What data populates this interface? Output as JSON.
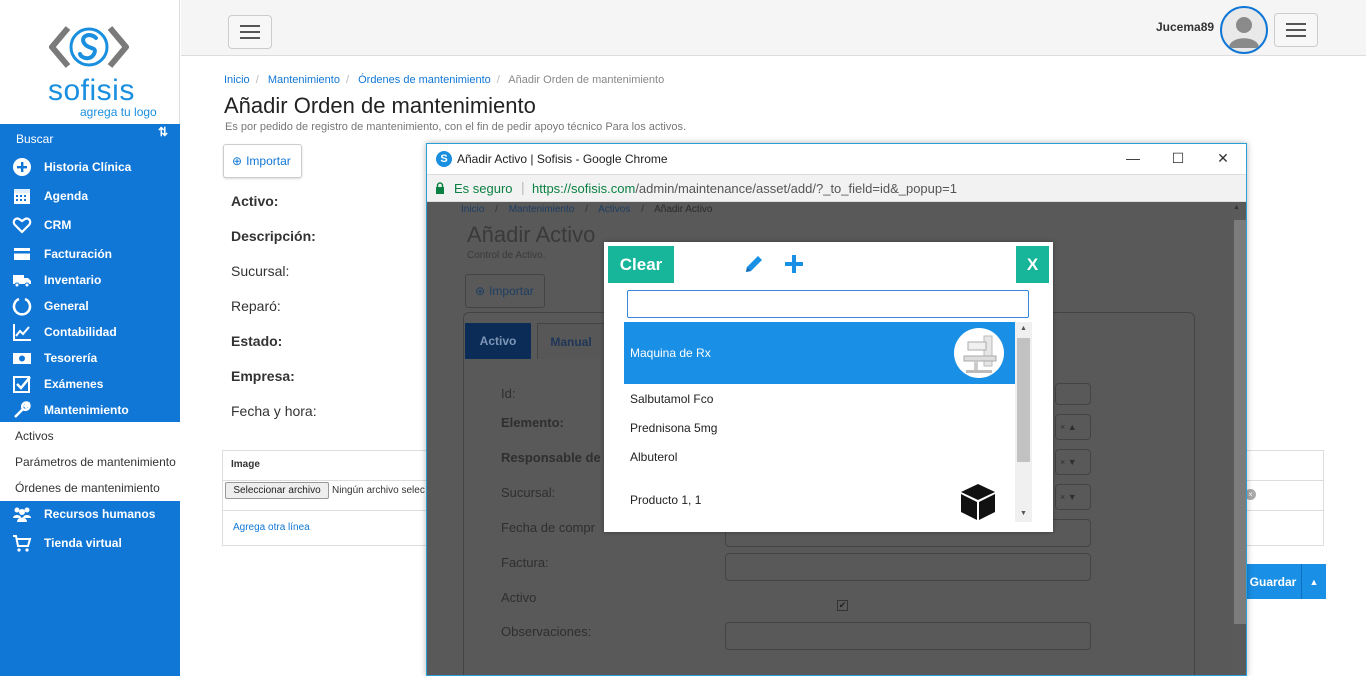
{
  "sidebar": {
    "logo_text": "sofisis",
    "logo_tagline": "agrega tu logo",
    "search_label": "Buscar",
    "items": [
      {
        "label": "Historia Clínica",
        "icon": "plus-square-icon"
      },
      {
        "label": "Agenda",
        "icon": "calendar-icon"
      },
      {
        "label": "CRM",
        "icon": "heart-icon"
      },
      {
        "label": "Facturación",
        "icon": "credit-card-icon"
      },
      {
        "label": "Inventario",
        "icon": "truck-icon"
      },
      {
        "label": "General",
        "icon": "circle-notch-icon"
      },
      {
        "label": "Contabilidad",
        "icon": "line-chart-icon"
      },
      {
        "label": "Tesorería",
        "icon": "money-icon"
      },
      {
        "label": "Exámenes",
        "icon": "check-square-icon"
      },
      {
        "label": "Mantenimiento",
        "icon": "wrench-icon"
      }
    ],
    "subitems": [
      {
        "label": "Activos"
      },
      {
        "label": "Parámetros de mantenimiento"
      },
      {
        "label": "Órdenes de mantenimiento"
      }
    ],
    "bottom_items": [
      {
        "label": "Recursos humanos",
        "icon": "users-icon"
      },
      {
        "label": "Tienda virtual",
        "icon": "cart-icon"
      }
    ]
  },
  "topbar": {
    "username": "Jucema89"
  },
  "main": {
    "breadcrumb": [
      "Inicio",
      "Mantenimiento",
      "Órdenes de mantenimiento",
      "Añadir Orden de mantenimiento"
    ],
    "title": "Añadir Orden de mantenimiento",
    "subtitle": "Es por pedido de registro de mantenimiento, con el fin de pedir apoyo técnico Para los activos.",
    "import_label": "Importar",
    "fields": [
      "Activo:",
      "Descripción:",
      "Sucursal:",
      "Reparó:",
      "Estado:",
      "Empresa:",
      "Fecha y hora:"
    ],
    "image_header": "Image",
    "file_button": "Seleccionar archivo",
    "file_none": "Ningún archivo selec",
    "add_line": "Agrega otra línea",
    "save_label": "Guardar"
  },
  "popup": {
    "window_title": "Añadir Activo | Sofisis - Google Chrome",
    "secure_label": "Es seguro",
    "url_host": "https://sofisis.com",
    "url_path": "/admin/maintenance/asset/add/?_to_field=id&_popup=1",
    "breadcrumb": [
      "Inicio",
      "Mantenimiento",
      "Activos",
      "Añadir Activo"
    ],
    "title": "Añadir Activo",
    "subtitle": "Control de Activo.",
    "import_label": "Importar",
    "tabs": [
      "Activo",
      "Manual"
    ],
    "fields": [
      "Id:",
      "Elemento:",
      "Responsable de",
      "Sucursal:",
      "Fecha de compr",
      "Factura:",
      "Activo",
      "Observaciones:"
    ]
  },
  "selector": {
    "clear_label": "Clear",
    "close_label": "X",
    "search_value": "",
    "items": [
      {
        "label": "Maquina de Rx",
        "selected": true
      },
      {
        "label": "Salbutamol Fco"
      },
      {
        "label": "Prednisona 5mg"
      },
      {
        "label": "Albuterol"
      },
      {
        "label": "Producto 1, 1"
      }
    ]
  },
  "colors": {
    "brand_blue": "#1177d6",
    "accent_teal": "#17b59a",
    "selection_blue": "#1a8fe6"
  }
}
